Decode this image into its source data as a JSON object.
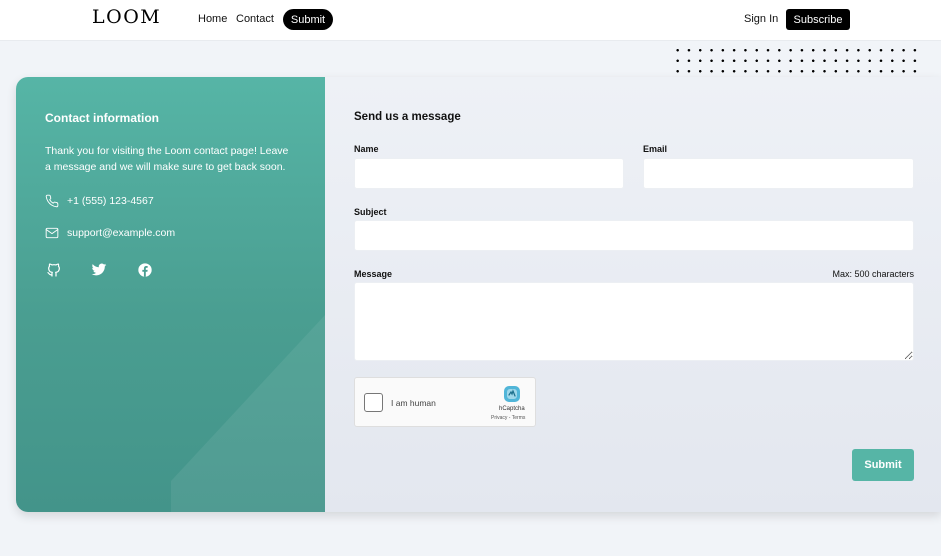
{
  "nav": {
    "logo": "LOOM",
    "links": [
      "Home",
      "Contact"
    ],
    "submit": "Submit",
    "sign_in": "Sign In",
    "subscribe": "Subscribe"
  },
  "contact_info": {
    "title": "Contact information",
    "text": "Thank you for visiting the Loom contact page! Leave a message and we will make sure to get back soon.",
    "phone": "+1 (555) 123-4567",
    "email": "support@example.com",
    "socials": [
      "github-icon",
      "twitter-icon",
      "facebook-icon"
    ]
  },
  "form": {
    "title": "Send us a message",
    "name_label": "Name",
    "email_label": "Email",
    "subject_label": "Subject",
    "message_label": "Message",
    "max_note": "Max: 500 characters",
    "name_value": "",
    "email_value": "",
    "subject_value": "",
    "message_value": "",
    "captcha": {
      "label": "I am human",
      "brand": "hCaptcha",
      "links": "Privacy - Terms"
    },
    "submit": "Submit"
  },
  "colors": {
    "accent": "#56b5a6",
    "accent_dark": "#43948a",
    "background": "#f1f4f8"
  }
}
